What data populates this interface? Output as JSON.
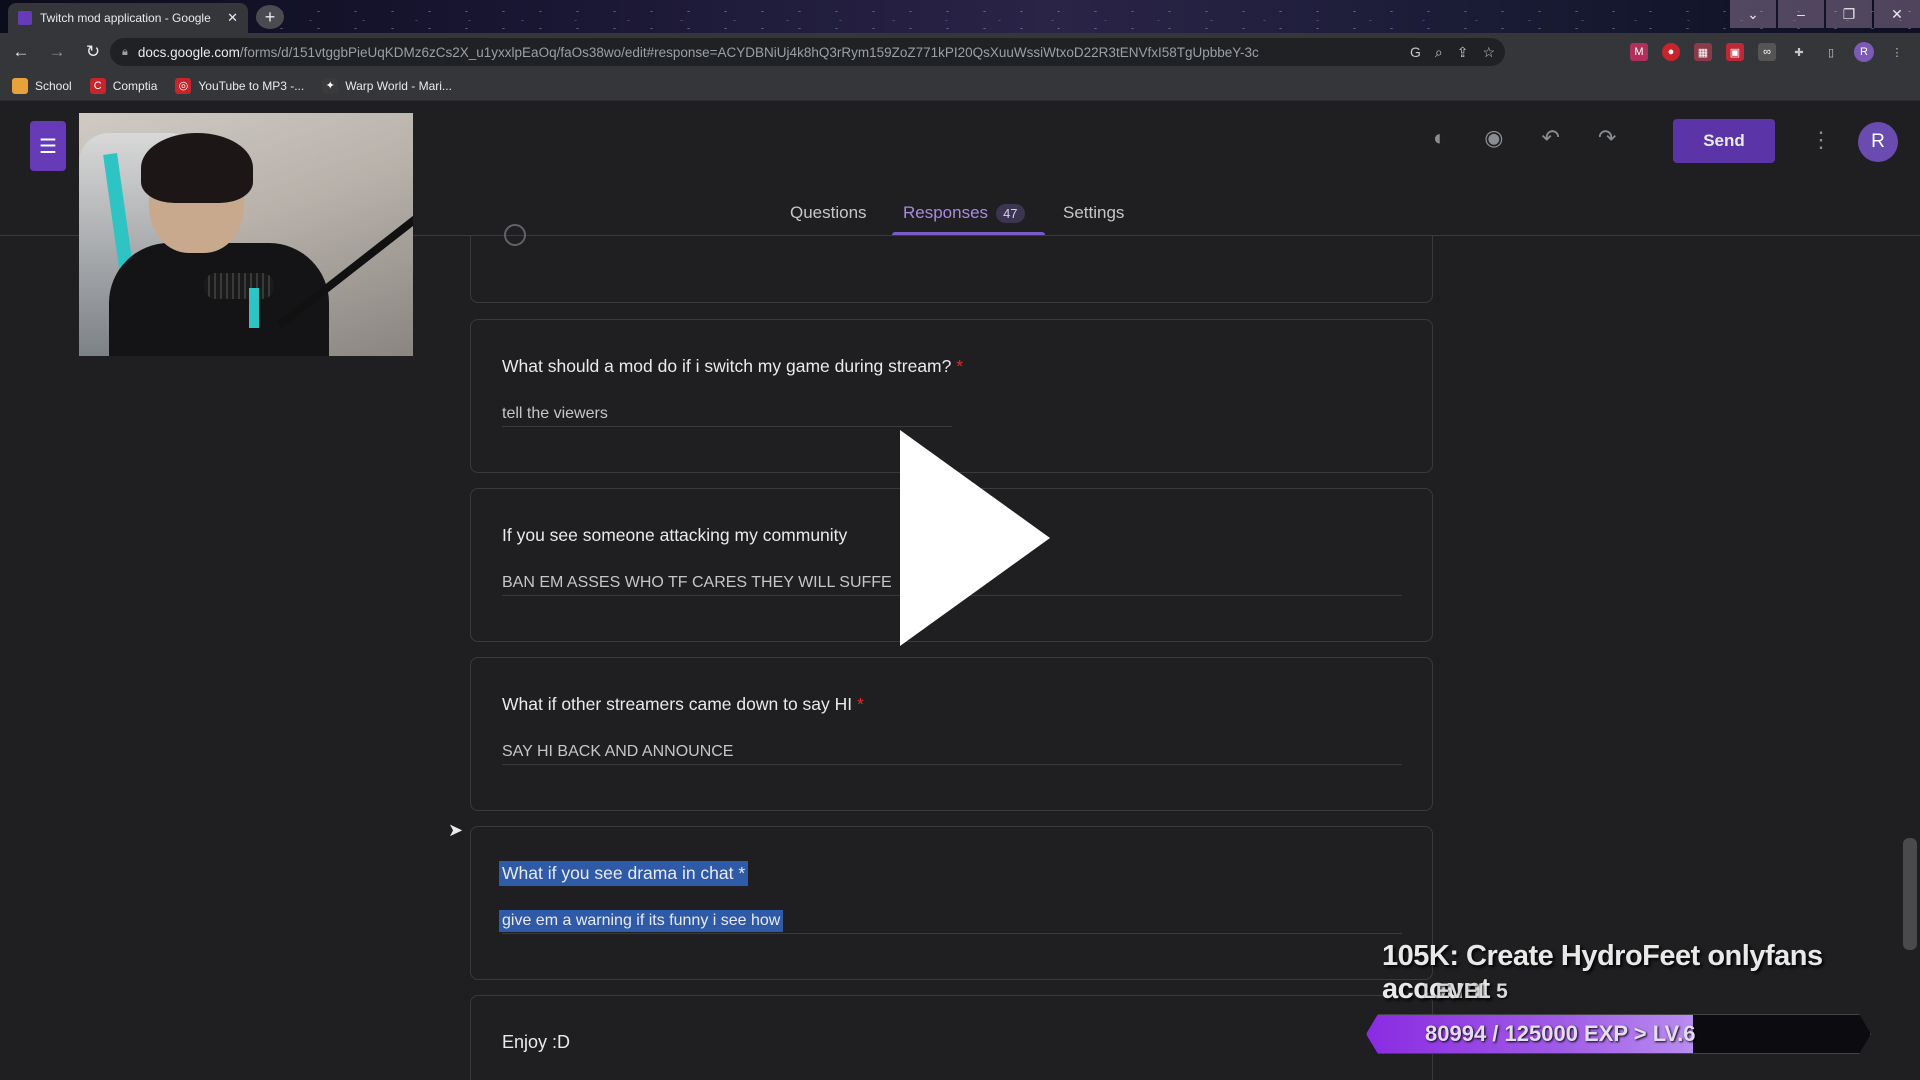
{
  "browser": {
    "tab_title": "Twitch mod application - Google",
    "tab_close": "✕",
    "new_tab": "+",
    "url_host": "docs.google.com",
    "url_path": "/forms/d/151vtggbPieUqKDMz6zCs2X_u1yxxlpEaOq/faOs38wo/edit#response=ACYDBNiUj4k8hQ3rRym159ZoZ771kPI20QsXuuWssiWtxoD22R3tENVfxI58TgUpbbeY-3c",
    "bookmarks": [
      {
        "label": "School",
        "color": "#e8a23a"
      },
      {
        "label": "Comptia",
        "color": "#c8242b"
      },
      {
        "label": "YouTube to MP3 -...",
        "color": "#c8242b"
      },
      {
        "label": "Warp World - Mari...",
        "color": "#3a3a3a"
      }
    ]
  },
  "forms": {
    "send_label": "Send",
    "avatar_initial": "R",
    "tabs": {
      "questions": "Questions",
      "responses": "Responses",
      "responses_count": "47",
      "settings": "Settings"
    }
  },
  "cards": [
    {
      "question": "What should a mod do if i switch my game during stream?",
      "required": "*",
      "answer": "tell the viewers"
    },
    {
      "question": "If you see someone attacking my community",
      "question_tail": "?",
      "required": "*",
      "answer": "BAN EM ASSES WHO TF CARES THEY WILL SUFFE"
    },
    {
      "question": "What if other streamers came down to say HI",
      "required": "*",
      "answer": "SAY HI BACK AND ANNOUNCE"
    },
    {
      "question": "What if you see drama in chat *",
      "answer": "give em a warning if its funny i see how"
    },
    {
      "text": "Enjoy :D"
    }
  ],
  "overlay": {
    "goal": "105K: Create HydroFeet onlyfans account",
    "level": "LEVEL 5",
    "xp_text": "80994 / 125000 EXP > LV.6",
    "xp_current": 80994,
    "xp_total": 125000
  },
  "colors": {
    "accent": "#673ab7",
    "send": "#5b35a8",
    "highlight": "#2f5aa8",
    "required": "#d93025"
  }
}
